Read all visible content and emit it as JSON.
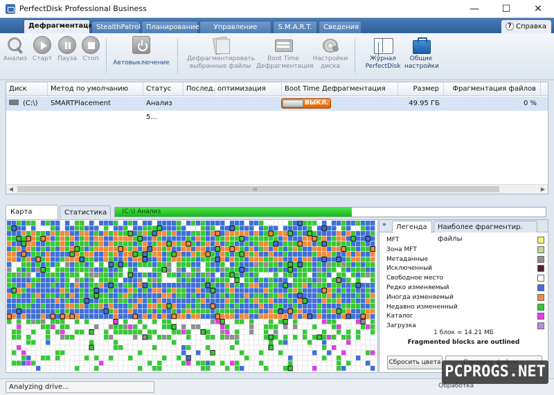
{
  "window": {
    "title": "PerfectDisk Professional Business",
    "controls": {
      "minimize": "—",
      "maximize": "☐",
      "close": "✕"
    }
  },
  "main_tabs": [
    {
      "label": "Дефрагментация",
      "active": true
    },
    {
      "label": "StealthPatrol"
    },
    {
      "label": "Планирование"
    },
    {
      "label": "Управление местом"
    },
    {
      "label": "S.M.A.R.T."
    },
    {
      "label": "Сведения"
    }
  ],
  "help": {
    "label": "Справка",
    "icon": "?"
  },
  "toolbar": {
    "analyze": "Анализ",
    "start": "Старт",
    "pause": "Пауза",
    "stop": "Стоп",
    "auto_off": "Автовыключение",
    "defrag_selected_l1": "Дефрагментировать",
    "defrag_selected_l2": "выбранные файлы",
    "boot_time_l1": "Boot Time",
    "boot_time_l2": "Дефрагментация",
    "disk_settings_l1": "Настройки",
    "disk_settings_l2": "диска",
    "journal_l1": "Журнал",
    "journal_l2": "PerfectDisk",
    "general_settings_l1": "Общие",
    "general_settings_l2": "настройки"
  },
  "table": {
    "columns": {
      "disk": "Диск",
      "method": "Метод по умолчанию",
      "status": "Статус",
      "last_opt": "Послед. оптимизация",
      "boot_time": "Boot Time Дефрагментация",
      "size": "Размер",
      "frag": "Фрагментация файлов"
    },
    "rows": [
      {
        "disk": "(C:\\)",
        "method": "SMARTPlacement",
        "status": "Анализ 5...",
        "last_opt": "",
        "boot_toggle": "ВЫКЛ.",
        "size": "49.95 ГБ",
        "frag": "0 %"
      }
    ],
    "scroll_left": "◀",
    "scroll_right": "▶",
    "scroll_grip": "III"
  },
  "lower_tabs": {
    "disk_map": "Карта диска",
    "statistics": "Статистика"
  },
  "progress": {
    "label": "(C:\\)  Анализ",
    "fraction": 0.55
  },
  "legend_panel": {
    "collapse": "»",
    "tab_legend": "Легенда",
    "tab_fragmented": "Наиболее фрагментир. файлы",
    "items": [
      {
        "label": "MFT",
        "color": "#f2f27a"
      },
      {
        "label": "Зона MFT",
        "color": "#c9d39c"
      },
      {
        "label": "Метаданные",
        "color": "#8f8f8f"
      },
      {
        "label": "Исключенный",
        "color": "#4a2426"
      },
      {
        "label": "Свободное место",
        "color": "#ffffff"
      },
      {
        "label": "Редко изменяемый",
        "color": "#3f6fd8"
      },
      {
        "label": "Иногда изменяемый",
        "color": "#f08a3c"
      },
      {
        "label": "Недавно измененный",
        "color": "#37c837"
      },
      {
        "label": "Каталог",
        "color": "#e040e0"
      },
      {
        "label": "Загрузка",
        "color": "#b68ee0"
      }
    ],
    "block_size": "1 блок = 14.21 МБ",
    "fragmented_note": "Fragmented blocks are outlined",
    "reset_button": "Сбросить цвета",
    "second_button": "Показать файлы..."
  },
  "statusbar": {
    "text": "Analyzing drive...",
    "right_text": "Обработка"
  },
  "watermark": "PCPROGS.NET",
  "colors": {
    "blue": "#3f6fd8",
    "orange": "#f08a3c",
    "green": "#37c837",
    "yellow": "#f2f27a",
    "gray": "#8f8f8f",
    "magenta": "#e040e0",
    "free": "#ffffff"
  }
}
